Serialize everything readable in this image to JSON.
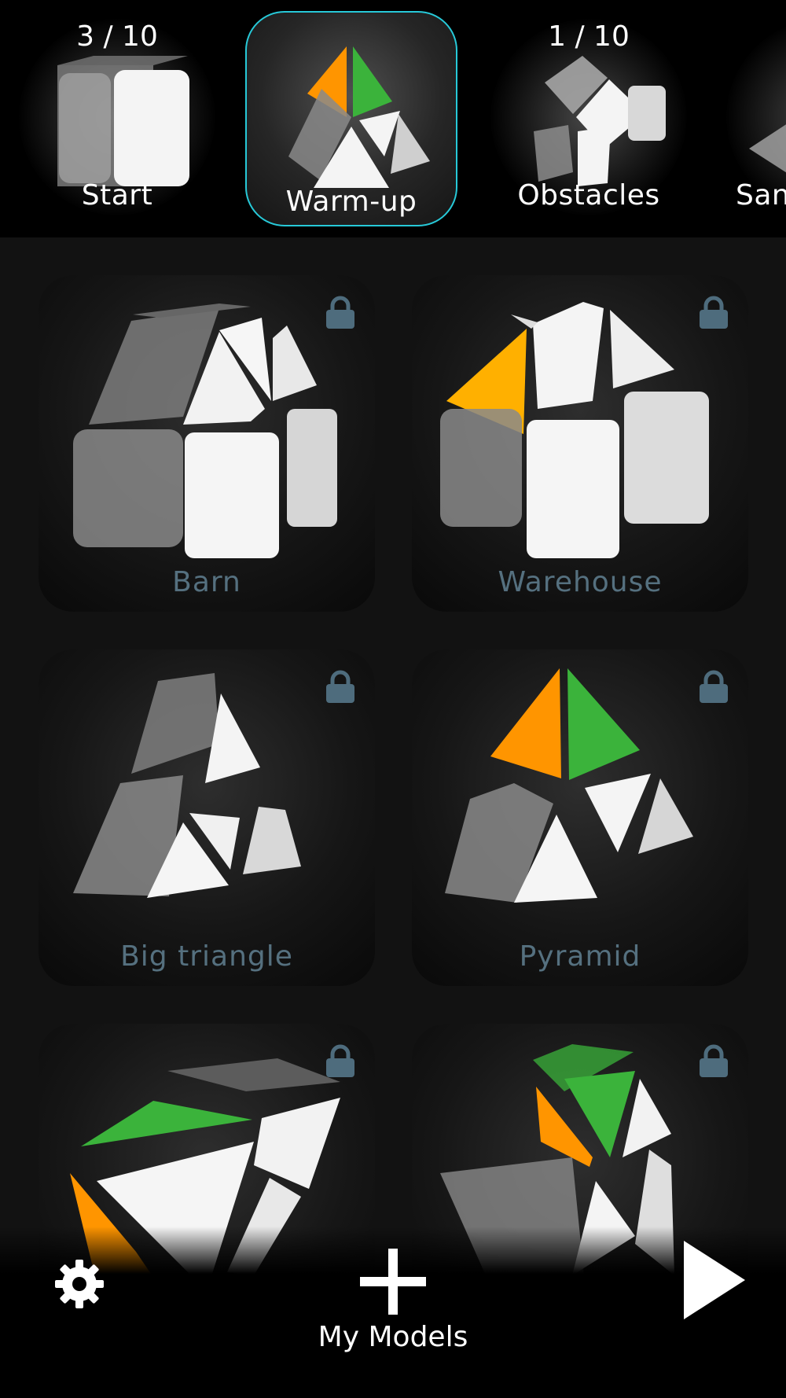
{
  "categories": [
    {
      "name": "Start",
      "count": "3 / 10",
      "selected": false
    },
    {
      "name": "Warm-up",
      "count": "",
      "selected": true
    },
    {
      "name": "Obstacles",
      "count": "1 / 10",
      "selected": false
    },
    {
      "name": "San",
      "count": "",
      "selected": false
    }
  ],
  "models": [
    {
      "label": "Barn",
      "locked": true
    },
    {
      "label": "Warehouse",
      "locked": true
    },
    {
      "label": "Big triangle",
      "locked": true
    },
    {
      "label": "Pyramid",
      "locked": true
    },
    {
      "label": "",
      "locked": true
    },
    {
      "label": "",
      "locked": true
    }
  ],
  "bottom": {
    "my_models_label": "My Models"
  },
  "colors": {
    "accent": "#27c9d8",
    "label": "#55707f",
    "orange": "#ff9500",
    "green": "#3bb33b",
    "lock": "#4e6c7d"
  },
  "icons": [
    "gear-icon",
    "plus-icon",
    "play-icon",
    "lock-icon"
  ]
}
